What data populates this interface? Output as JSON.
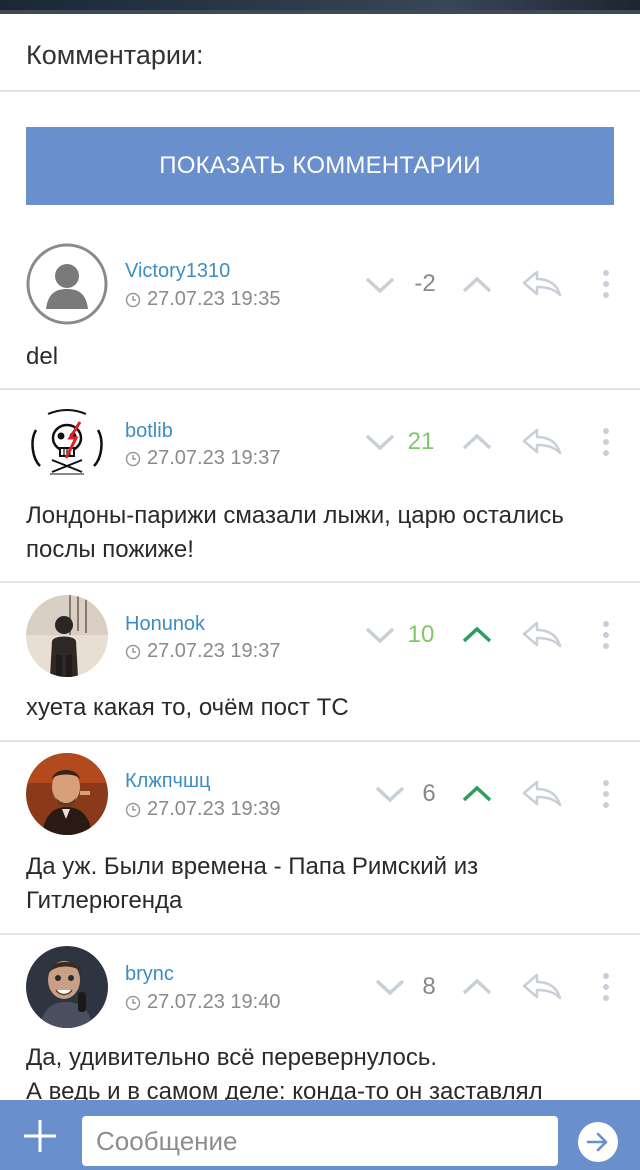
{
  "header": {
    "title": "Комментарии:"
  },
  "show_comments_button": {
    "label": "ПОКАЗАТЬ КОММЕНТАРИИ"
  },
  "colors": {
    "accent": "#6990cc",
    "username": "#3d8dc2",
    "positive_score": "#7cc96c",
    "neutral_score": "#888888",
    "upvote_active": "#2aa05a",
    "icon_inactive": "#c9cfd6"
  },
  "comments": [
    {
      "username": "Victory1310",
      "time": "27.07.23 19:35",
      "score": "-2",
      "score_state": "neutral",
      "upvoted": false,
      "text": "del"
    },
    {
      "username": "botlib",
      "time": "27.07.23 19:37",
      "score": "21",
      "score_state": "positive",
      "upvoted": false,
      "text": "Лондоны-парижи смазали лыжи, царю остались послы пожиже!"
    },
    {
      "username": "Honunok",
      "time": "27.07.23 19:37",
      "score": "10",
      "score_state": "positive",
      "upvoted": true,
      "text": "хуета какая то, очём пост ТС"
    },
    {
      "username": "Клжпчшц",
      "time": "27.07.23 19:39",
      "score": "6",
      "score_state": "neutral",
      "upvoted": true,
      "text": "Да уж. Были времена - Папа Римский из Гитлерюгенда"
    },
    {
      "username": "brync",
      "time": "27.07.23 19:40",
      "score": "8",
      "score_state": "neutral",
      "upvoted": false,
      "text_lines": [
        "Да, удивительно всё перевернулось.",
        "А ведь и в самом деле: конда-то он заставлял"
      ]
    }
  ],
  "composer": {
    "placeholder": "Сообщение"
  }
}
